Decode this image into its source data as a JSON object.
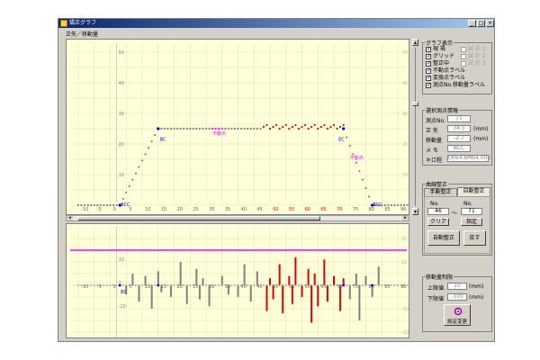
{
  "window": {
    "title": "矯正グラフ",
    "content_label": "正矢／移動量"
  },
  "top_chart": {
    "x_ticks": [
      "-10",
      "-5",
      "0",
      "5",
      "10",
      "15",
      "20",
      "25",
      "30",
      "35",
      "40",
      "45",
      "50",
      "55",
      "60",
      "65",
      "70",
      "75",
      "80",
      "85",
      "90"
    ],
    "highlight_ticks": [
      "50",
      "55",
      "60",
      "65",
      "70"
    ],
    "y_ticks": [
      "50",
      "40",
      "30",
      "20",
      "10"
    ],
    "right_ticks": [
      "50",
      "40",
      "30",
      "20",
      "10"
    ],
    "labels": {
      "bcc": "BCC",
      "bc": "BC",
      "ecc": "ECC",
      "ec": "EC",
      "fixed_left": "不動点",
      "fixed_right": "不動点"
    }
  },
  "bottom_chart": {
    "x_ticks": [
      "-10",
      "-5",
      "0",
      "5",
      "10",
      "15",
      "20",
      "25",
      "30",
      "35",
      "40",
      "45",
      "50",
      "55",
      "60",
      "65",
      "70",
      "75",
      "80",
      "85",
      "90"
    ],
    "y_ticks": [
      "10",
      "0",
      "-10"
    ],
    "right_ticks": [
      "20",
      "10",
      "0",
      "-10",
      "-20"
    ],
    "label_bc": "BC"
  },
  "graph_display": {
    "title": "グラフ表示",
    "options": [
      {
        "label": "現 場",
        "checked": true,
        "enabled": true
      },
      {
        "label": "グリッド",
        "checked": true,
        "enabled": true
      },
      {
        "label": "整正中",
        "checked": true,
        "enabled": true
      },
      {
        "label": "不動点ラベル",
        "checked": true,
        "enabled": true
      },
      {
        "label": "変換点ラベル",
        "checked": true,
        "enabled": true
      },
      {
        "label": "測点No.移動量ラベル",
        "checked": true,
        "enabled": true
      }
    ],
    "disabled_options": [
      "試 計 1",
      "試 計 2",
      "試 計 3"
    ]
  },
  "selected_point": {
    "title": "選択測点情報",
    "rows": [
      {
        "label": "測点No.",
        "value": "71",
        "unit": ""
      },
      {
        "label": "正 矢",
        "value": "34.5",
        "unit": "(mm)"
      },
      {
        "label": "移動量",
        "value": "-2.7",
        "unit": "(mm)"
      },
      {
        "label": "メ モ",
        "value": "BCC",
        "unit": ""
      },
      {
        "label": "キロ程",
        "value": "0K64.8M64.000",
        "unit": ""
      }
    ]
  },
  "curve_correction": {
    "title": "曲線整正",
    "tabs": [
      "手動整正",
      "自動整正"
    ],
    "no_label": "No.",
    "from_value": "46",
    "tilde": "〜",
    "to_value": "71",
    "clear_label": "クリア",
    "designate_label": "指定",
    "auto_label": "自動整正",
    "back_label": "戻す"
  },
  "movement_limit": {
    "title": "移動量制限",
    "upper_label": "上限値",
    "upper_value": "10",
    "lower_label": "下限値",
    "lower_value": "-100",
    "unit": "(mm)",
    "apply_label": "設定変更"
  },
  "colors": {
    "highlight": "#e00000",
    "magenta": "#ff00ff",
    "series": "#808080",
    "accent": "#0000cc"
  }
}
